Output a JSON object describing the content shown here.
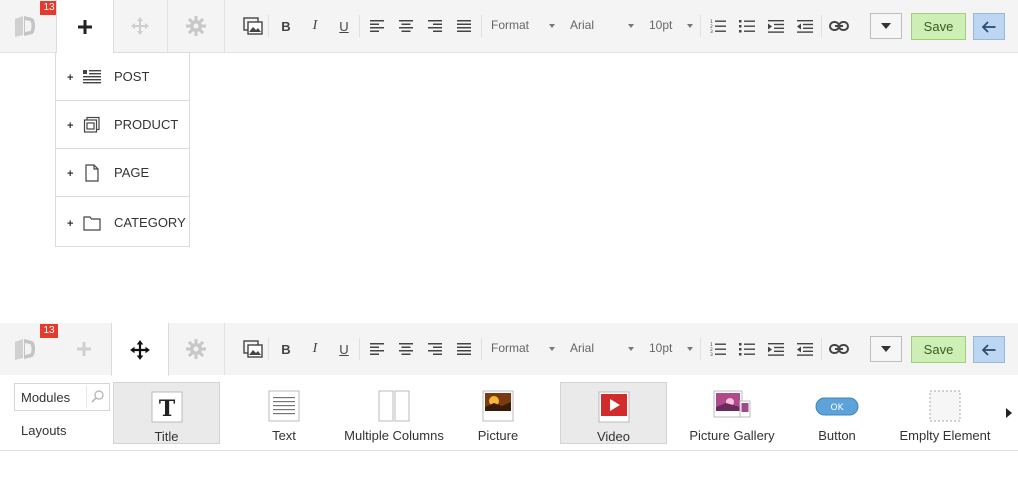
{
  "badge_count": "13",
  "toolbar": {
    "format_label": "Format",
    "font_label": "Arial",
    "size_label": "10pt",
    "save_label": "Save"
  },
  "add_menu": {
    "items": [
      {
        "label": "POST",
        "icon": "post-icon"
      },
      {
        "label": "PRODUCT",
        "icon": "product-icon"
      },
      {
        "label": "PAGE",
        "icon": "page-icon"
      },
      {
        "label": "CATEGORY",
        "icon": "category-icon"
      }
    ]
  },
  "modules_panel": {
    "search_value": "Modules",
    "layouts_label": "Layouts",
    "modules": [
      {
        "label": "Title",
        "icon": "title-icon",
        "selected": true
      },
      {
        "label": "Text",
        "icon": "text-icon",
        "selected": false
      },
      {
        "label": "Multiple Columns",
        "icon": "columns-icon",
        "selected": false
      },
      {
        "label": "Picture",
        "icon": "picture-icon",
        "selected": false
      },
      {
        "label": "Video",
        "icon": "video-icon",
        "selected": true
      },
      {
        "label": "Picture Gallery",
        "icon": "gallery-icon",
        "selected": false
      },
      {
        "label": "Button",
        "icon": "button-icon",
        "button_text": "OK",
        "selected": false
      },
      {
        "label": "Emplty Element",
        "icon": "empty-element-icon",
        "selected": false
      }
    ]
  },
  "colors": {
    "badge": "#e53b2c",
    "save_bg": "#cdeeb4",
    "back_bg": "#bdd7f3",
    "video_red": "#d22b2b",
    "button_blue": "#5da2d8"
  }
}
